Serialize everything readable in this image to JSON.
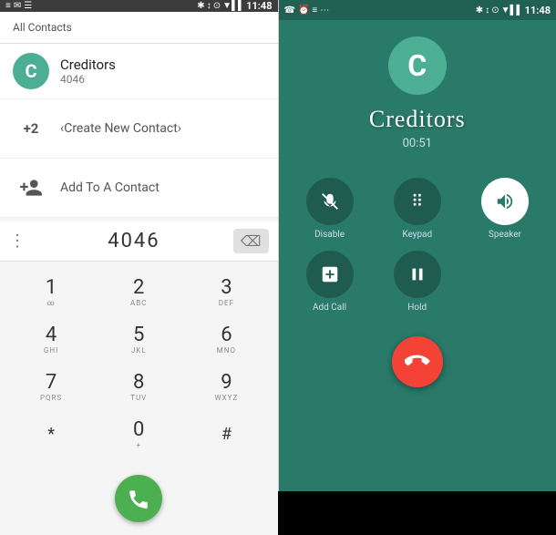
{
  "left": {
    "status_bar": {
      "time": "11:48",
      "left_icons": "≡ ✉ ☰",
      "right_icons": "✱ ↕ ⊙ ▼ ▌▌▌ 🔋"
    },
    "all_contacts_label": "All Contacts",
    "contact": {
      "avatar_letter": "C",
      "name": "Creditors",
      "number": "4046"
    },
    "create_contact": {
      "prefix": "+2",
      "label": "‹Create New Contact›"
    },
    "add_contact": {
      "label": "Add To A Contact"
    },
    "dialer": {
      "number": "4046",
      "keys": [
        {
          "digit": "1",
          "sub": "∞"
        },
        {
          "digit": "2",
          "sub": "ABC"
        },
        {
          "digit": "3",
          "sub": "DEF"
        },
        {
          "digit": "4",
          "sub": "GHI"
        },
        {
          "digit": "5",
          "sub": "JKL"
        },
        {
          "digit": "6",
          "sub": "MNO"
        },
        {
          "digit": "7",
          "sub": "PQRS"
        },
        {
          "digit": "8",
          "sub": "TUV"
        },
        {
          "digit": "9",
          "sub": "WXYZ"
        },
        {
          "digit": "*",
          "sub": ""
        },
        {
          "digit": "0",
          "sub": "+"
        },
        {
          "digit": "#",
          "sub": ""
        }
      ]
    }
  },
  "right": {
    "status_bar": {
      "time": "11:48",
      "left_icons": "☎ ⏰ ≡ ⋯",
      "right_icons": "✱ ↕ ⊙ ▼ ▌▌▌ 🔋"
    },
    "avatar_letter": "C",
    "caller_name": "Creditors",
    "call_duration": "00:51",
    "controls": [
      {
        "icon": "🎤",
        "label": "Disable",
        "style": "dark-bg",
        "crossed": true
      },
      {
        "icon": "⠿",
        "label": "Keypad",
        "style": "dark-bg"
      },
      {
        "icon": "🔊",
        "label": "Speaker",
        "style": "white-bg"
      },
      {
        "icon": "T",
        "label": "Add Call",
        "style": "dark-bg"
      },
      {
        "icon": "⏸",
        "label": "Hold",
        "style": "dark-bg"
      },
      {
        "icon": "",
        "label": "",
        "style": "hidden"
      }
    ]
  }
}
